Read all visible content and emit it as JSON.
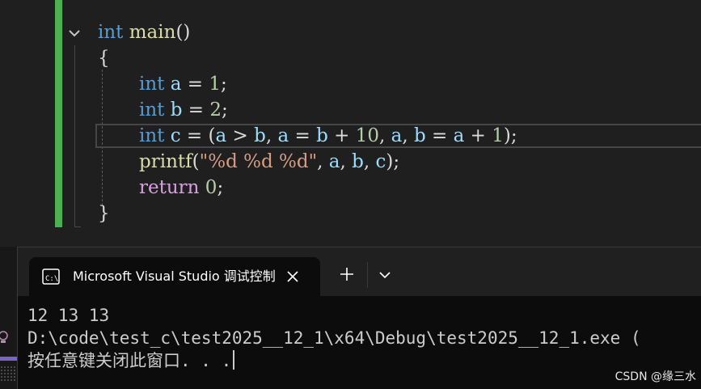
{
  "editor": {
    "signature": {
      "type": "int",
      "name": "main",
      "parens": "()"
    },
    "open_brace": "{",
    "close_brace": "}",
    "line_a": {
      "type": "int",
      "var": "a",
      "op": " = ",
      "val": "1",
      "end": ";"
    },
    "line_b": {
      "type": "int",
      "var": "b",
      "op": " = ",
      "val": "2",
      "end": ";"
    },
    "line_c": {
      "type": "int",
      "var": "c",
      "parts": [
        " = (",
        "a",
        " > ",
        "b",
        ", ",
        "a",
        " = ",
        "b",
        " + ",
        "10",
        ", ",
        "a",
        ", ",
        "b",
        " = ",
        "a",
        " + ",
        "1",
        ");"
      ]
    },
    "line_printf": {
      "fn": "printf",
      "open": "(",
      "fmt": "\"%d %d %d\"",
      "sep1": ", ",
      "a": "a",
      "sep2": ", ",
      "b": "b",
      "sep3": ", ",
      "c": "c",
      "end": ");"
    },
    "line_return": {
      "kw": "return",
      "val": "0",
      "end": ";"
    }
  },
  "console": {
    "tab_title": "Microsoft Visual Studio 调试控制台",
    "output": [
      "12 13 13",
      "D:\\code\\test_c\\test2025__12_1\\x64\\Debug\\test2025__12_1.exe (",
      "按任意键关闭此窗口. . ."
    ]
  },
  "watermark": "CSDN @缘三水",
  "colors": {
    "change_bar": "#4caf50",
    "keyword": "#569cd6",
    "control_keyword": "#d8a0df",
    "function": "#dcdcaa",
    "variable": "#9cdcfe",
    "number": "#b5cea8",
    "string": "#d69d85"
  },
  "icons": {
    "fold": "chevron-down-icon",
    "console": "console-icon",
    "close": "close-icon",
    "new_tab": "plus-icon",
    "dropdown": "chevron-down-icon",
    "bulb": "lightbulb-icon"
  }
}
